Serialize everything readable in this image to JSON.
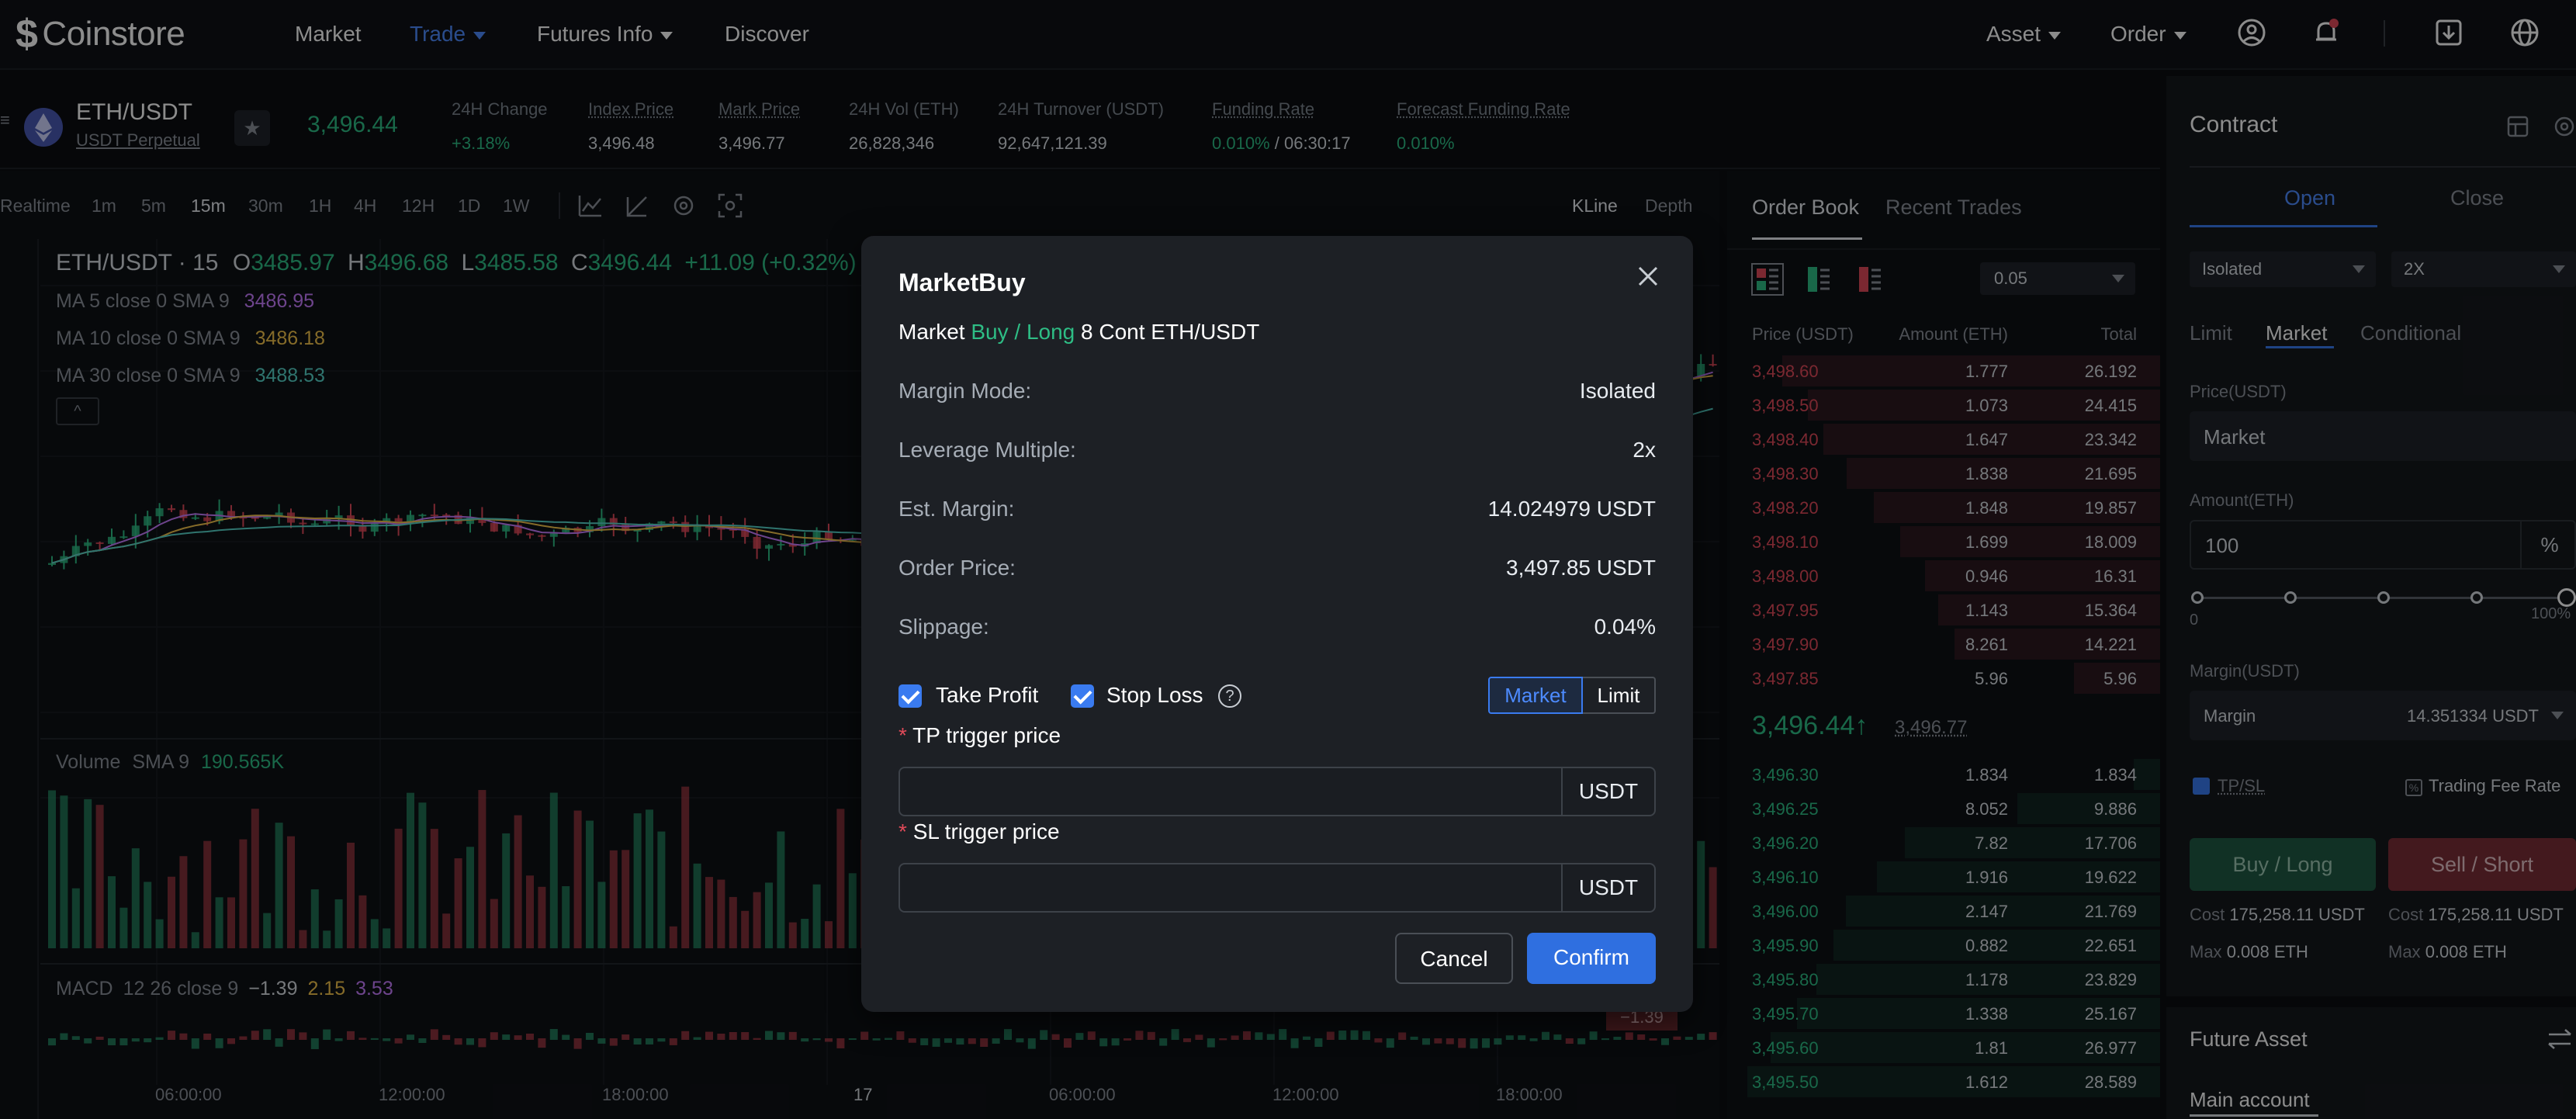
{
  "nav": {
    "logo": "Coinstore",
    "items": [
      {
        "label": "Market"
      },
      {
        "label": "Trade"
      },
      {
        "label": "Futures Info"
      },
      {
        "label": "Discover"
      }
    ],
    "right": [
      {
        "label": "Asset"
      },
      {
        "label": "Order"
      }
    ],
    "icons": [
      "user-icon",
      "bell-icon",
      "download-icon",
      "globe-icon"
    ]
  },
  "ticker": {
    "pair": "ETH/USDT",
    "subtitle": "USDT Perpetual",
    "last_price": "3,496.44",
    "stats": [
      {
        "label": "24H Change",
        "value": "+3.18%"
      },
      {
        "label": "Index Price",
        "value": "3,496.48"
      },
      {
        "label": "Mark Price",
        "value": "3,496.77"
      },
      {
        "label": "24H Vol (ETH)",
        "value": "26,828,346"
      },
      {
        "label": "24H Turnover (USDT)",
        "value": "92,647,121.39"
      },
      {
        "label": "Funding Rate",
        "value": "0.010%",
        "extra": "/ 06:30:17"
      },
      {
        "label": "Forecast Funding Rate",
        "value": "0.010%"
      }
    ]
  },
  "chart": {
    "timeframes": [
      "Realtime",
      "1m",
      "5m",
      "15m",
      "30m",
      "1H",
      "4H",
      "12H",
      "1D",
      "1W"
    ],
    "active_tf": "15m",
    "views": [
      "KLine",
      "Depth"
    ],
    "ohlc": {
      "title": "ETH/USDT · 15",
      "o_label": "O",
      "o": "3485.97",
      "h_label": "H",
      "h": "3496.68",
      "l_label": "L",
      "l": "3485.58",
      "c_label": "C",
      "c": "3496.44",
      "chg": "+11.09 (+0.32%)"
    },
    "ma": [
      {
        "label": "MA 5 close 0 SMA 9",
        "value": "3486.95",
        "color": "#c77dff"
      },
      {
        "label": "MA 10 close 0 SMA 9",
        "value": "3486.18",
        "color": "#f3c44b"
      },
      {
        "label": "MA 30 close 0 SMA 9",
        "value": "3488.53",
        "color": "#56d3c9"
      }
    ],
    "volume": {
      "label": "Volume",
      "sma": "SMA 9",
      "value": "190.565K"
    },
    "macd": {
      "label": "MACD",
      "params": "12 26 close 9",
      "v1": "−1.39",
      "v2": "2.15",
      "v3": "3.53",
      "tag": "−1.39"
    },
    "x_labels": [
      "06:00:00",
      "12:00:00",
      "18:00:00",
      "17",
      "06:00:00",
      "12:00:00",
      "18:00:00"
    ]
  },
  "orderbook": {
    "tabs": [
      "Order Book",
      "Recent Trades"
    ],
    "precision": "0.05",
    "headers": [
      "Price (USDT)",
      "Amount (ETH)",
      "Total"
    ],
    "asks": [
      {
        "p": "3,498.60",
        "a": "1.777",
        "t": "26.192"
      },
      {
        "p": "3,498.50",
        "a": "1.073",
        "t": "24.415"
      },
      {
        "p": "3,498.40",
        "a": "1.647",
        "t": "23.342"
      },
      {
        "p": "3,498.30",
        "a": "1.838",
        "t": "21.695"
      },
      {
        "p": "3,498.20",
        "a": "1.848",
        "t": "19.857"
      },
      {
        "p": "3,498.10",
        "a": "1.699",
        "t": "18.009"
      },
      {
        "p": "3,498.00",
        "a": "0.946",
        "t": "16.31"
      },
      {
        "p": "3,497.95",
        "a": "1.143",
        "t": "15.364"
      },
      {
        "p": "3,497.90",
        "a": "8.261",
        "t": "14.221"
      },
      {
        "p": "3,497.85",
        "a": "5.96",
        "t": "5.96"
      }
    ],
    "mid": {
      "price": "3,496.44",
      "arrow": "↑",
      "mark": "3,496.77"
    },
    "bids": [
      {
        "p": "3,496.30",
        "a": "1.834",
        "t": "1.834"
      },
      {
        "p": "3,496.25",
        "a": "8.052",
        "t": "9.886"
      },
      {
        "p": "3,496.20",
        "a": "7.82",
        "t": "17.706"
      },
      {
        "p": "3,496.10",
        "a": "1.916",
        "t": "19.622"
      },
      {
        "p": "3,496.00",
        "a": "2.147",
        "t": "21.769"
      },
      {
        "p": "3,495.90",
        "a": "0.882",
        "t": "22.651"
      },
      {
        "p": "3,495.80",
        "a": "1.178",
        "t": "23.829"
      },
      {
        "p": "3,495.70",
        "a": "1.338",
        "t": "25.167"
      },
      {
        "p": "3,495.60",
        "a": "1.81",
        "t": "26.977"
      },
      {
        "p": "3,495.50",
        "a": "1.612",
        "t": "28.589"
      }
    ]
  },
  "contract": {
    "title": "Contract",
    "tabs": [
      "Open",
      "Close"
    ],
    "margin_mode": "Isolated",
    "leverage": "2X",
    "order_types": [
      "Limit",
      "Market",
      "Conditional"
    ],
    "price_label": "Price(USDT)",
    "price_value": "Market",
    "amount_label": "Amount(ETH)",
    "amount_value": "100",
    "amount_unit": "%",
    "slider_min": "0",
    "slider_max": "100%",
    "margin_label": "Margin(USDT)",
    "margin_field": "Margin",
    "margin_value": "14.351334 USDT",
    "tpsl": "TP/SL",
    "fee": "Trading Fee Rate",
    "buy": "Buy / Long",
    "sell": "Sell / Short",
    "cost_label": "Cost",
    "cost_buy": "175,258.11 USDT",
    "cost_sell": "175,258.11 USDT",
    "max_label": "Max",
    "max_buy": "0.008 ETH",
    "max_sell": "0.008 ETH",
    "future_asset": "Future Asset",
    "main_account": "Main account"
  },
  "modal": {
    "title": "MarketBuy",
    "subtitle_prefix": "Market",
    "subtitle_side": "Buy / Long",
    "subtitle_rest": "8 Cont ETH/USDT",
    "rows": [
      {
        "label": "Margin Mode:",
        "value": "Isolated"
      },
      {
        "label": "Leverage Multiple:",
        "value": "2x"
      },
      {
        "label": "Est. Margin:",
        "value": "14.024979 USDT"
      },
      {
        "label": "Order Price:",
        "value": "3,497.85 USDT"
      },
      {
        "label": "Slippage:",
        "value": "0.04%"
      }
    ],
    "take_profit": "Take Profit",
    "stop_loss": "Stop Loss",
    "seg_market": "Market",
    "seg_limit": "Limit",
    "tp_label": "TP trigger price",
    "sl_label": "SL trigger price",
    "unit": "USDT",
    "cancel": "Cancel",
    "confirm": "Confirm"
  },
  "colors": {
    "accent": "#3a7bf0",
    "up": "#2ebd85",
    "down": "#e04a59"
  }
}
